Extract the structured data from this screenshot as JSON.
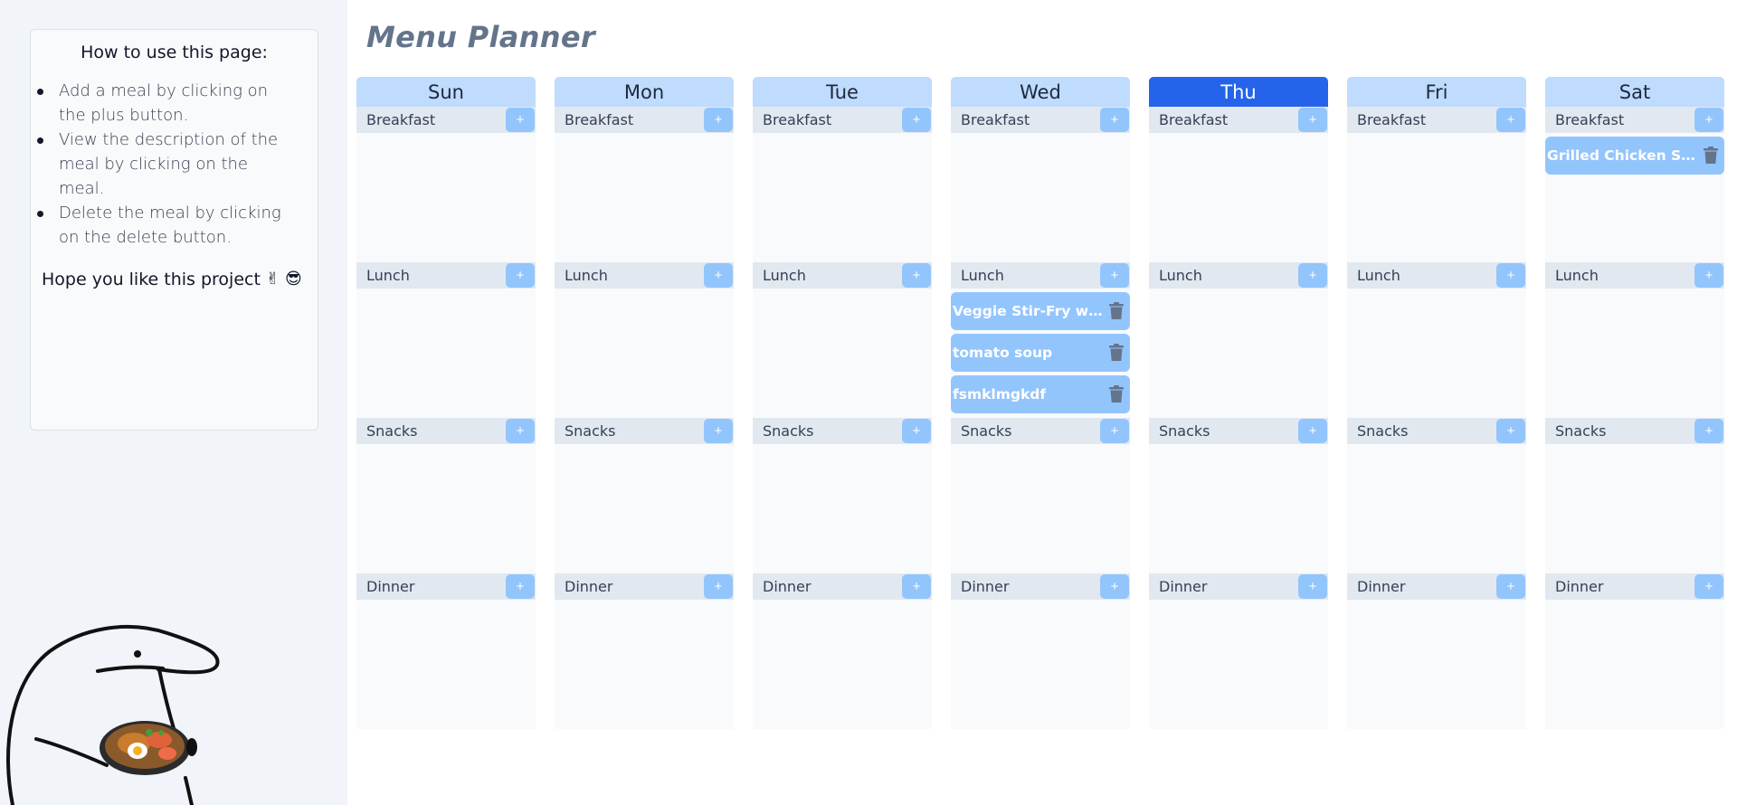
{
  "help": {
    "title": "How to use this page:",
    "items": [
      "Add a meal by clicking on the plus button.",
      "View the description of the meal by clicking on the meal.",
      "Delete the meal by clicking on the delete button."
    ],
    "outro": "Hope you like this project",
    "outro_emojis": [
      "✌",
      "😎"
    ]
  },
  "page_title": "Menu Planner",
  "add_label": "+",
  "slots": [
    "Breakfast",
    "Lunch",
    "Snacks",
    "Dinner"
  ],
  "colors": {
    "active_day": "#2563eb",
    "day_header": "#bfdbfe",
    "meal": "#93c5fd",
    "slot_bar": "#e2e8f0"
  },
  "days": [
    {
      "name": "Sun",
      "active": false,
      "meals": {
        "Breakfast": [],
        "Lunch": [],
        "Snacks": [],
        "Dinner": []
      }
    },
    {
      "name": "Mon",
      "active": false,
      "meals": {
        "Breakfast": [],
        "Lunch": [],
        "Snacks": [],
        "Dinner": []
      }
    },
    {
      "name": "Tue",
      "active": false,
      "meals": {
        "Breakfast": [],
        "Lunch": [],
        "Snacks": [],
        "Dinner": []
      }
    },
    {
      "name": "Wed",
      "active": false,
      "meals": {
        "Breakfast": [],
        "Lunch": [
          "Veggie Stir-Fry with T...",
          "tomato soup",
          "fsmklmgkdf"
        ],
        "Snacks": [],
        "Dinner": []
      }
    },
    {
      "name": "Thu",
      "active": true,
      "meals": {
        "Breakfast": [],
        "Lunch": [],
        "Snacks": [],
        "Dinner": []
      }
    },
    {
      "name": "Fri",
      "active": false,
      "meals": {
        "Breakfast": [],
        "Lunch": [],
        "Snacks": [],
        "Dinner": []
      }
    },
    {
      "name": "Sat",
      "active": false,
      "meals": {
        "Breakfast": [
          "Grilled Chicken Salad"
        ],
        "Lunch": [],
        "Snacks": [],
        "Dinner": []
      }
    }
  ]
}
